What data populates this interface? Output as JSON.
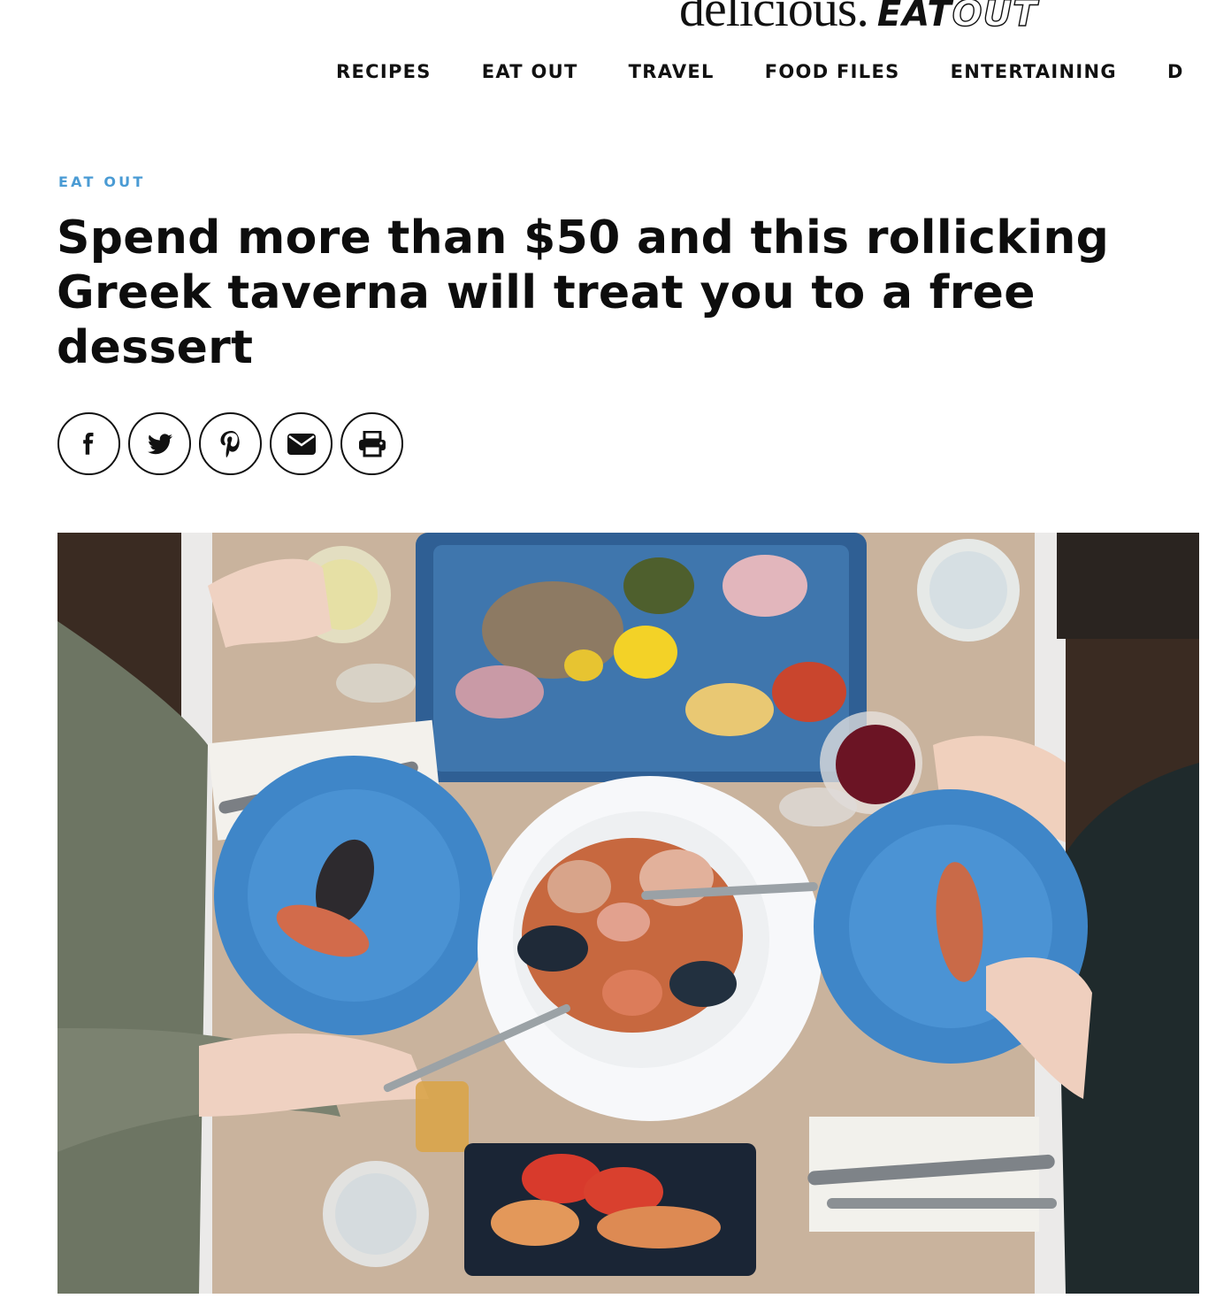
{
  "site": {
    "logo_word": "delicious.",
    "logo_eat": "EAT",
    "logo_out": "OUT"
  },
  "nav": {
    "items": [
      {
        "label": "RECIPES"
      },
      {
        "label": "EAT OUT"
      },
      {
        "label": "TRAVEL"
      },
      {
        "label": "FOOD FILES"
      },
      {
        "label": "ENTERTAINING"
      },
      {
        "label": "D"
      }
    ]
  },
  "article": {
    "kicker": "EAT OUT",
    "title": "Spend more than $50 and this rollicking Greek taverna will treat you to a free dessert"
  },
  "share": {
    "buttons": [
      {
        "icon": "facebook-icon"
      },
      {
        "icon": "twitter-icon"
      },
      {
        "icon": "pinterest-icon"
      },
      {
        "icon": "email-icon"
      },
      {
        "icon": "print-icon"
      }
    ]
  },
  "colors": {
    "accent": "#4a9bd4",
    "text": "#111111",
    "background": "#ffffff"
  },
  "hero": {
    "description_icon": "food-photo-image"
  }
}
